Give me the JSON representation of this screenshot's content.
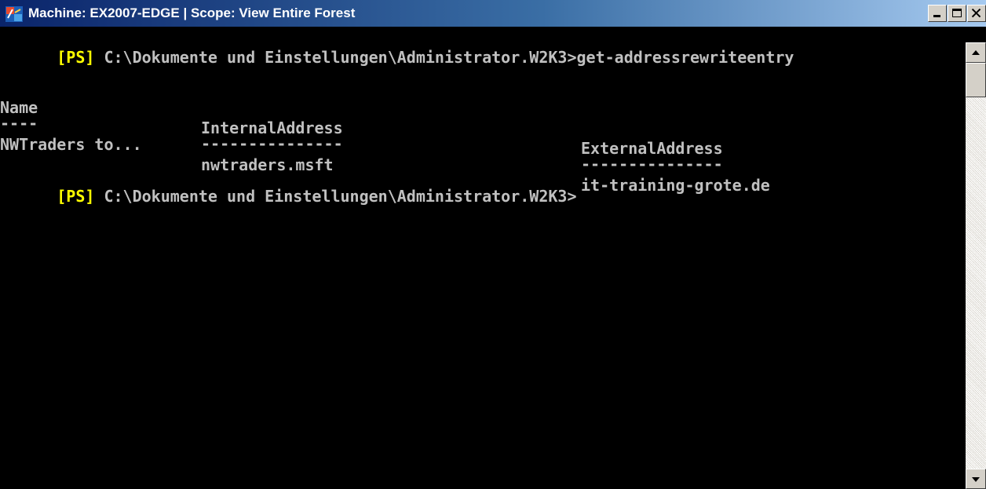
{
  "window": {
    "title": "Machine: EX2007-EDGE | Scope: View Entire Forest",
    "icon": "exchange-management-shell-icon",
    "buttons": {
      "minimize": "minimize",
      "maximize": "maximize",
      "close": "close"
    }
  },
  "console": {
    "prompt_prefix": "[PS]",
    "prompt_path": " C:\\Dokumente und Einstellungen\\Administrator.W2K3>",
    "command": "get-addressrewriteentry",
    "table": {
      "headers": [
        "Name",
        "InternalAddress",
        "ExternalAddress"
      ],
      "underlines": [
        "----",
        "---------------",
        "---------------"
      ],
      "rows": [
        [
          "NWTraders to...",
          "nwtraders.msft",
          "it-training-grote.de"
        ]
      ]
    },
    "colors": {
      "background": "#000000",
      "text": "#c0c0c0",
      "prompt": "#ffff00"
    }
  }
}
